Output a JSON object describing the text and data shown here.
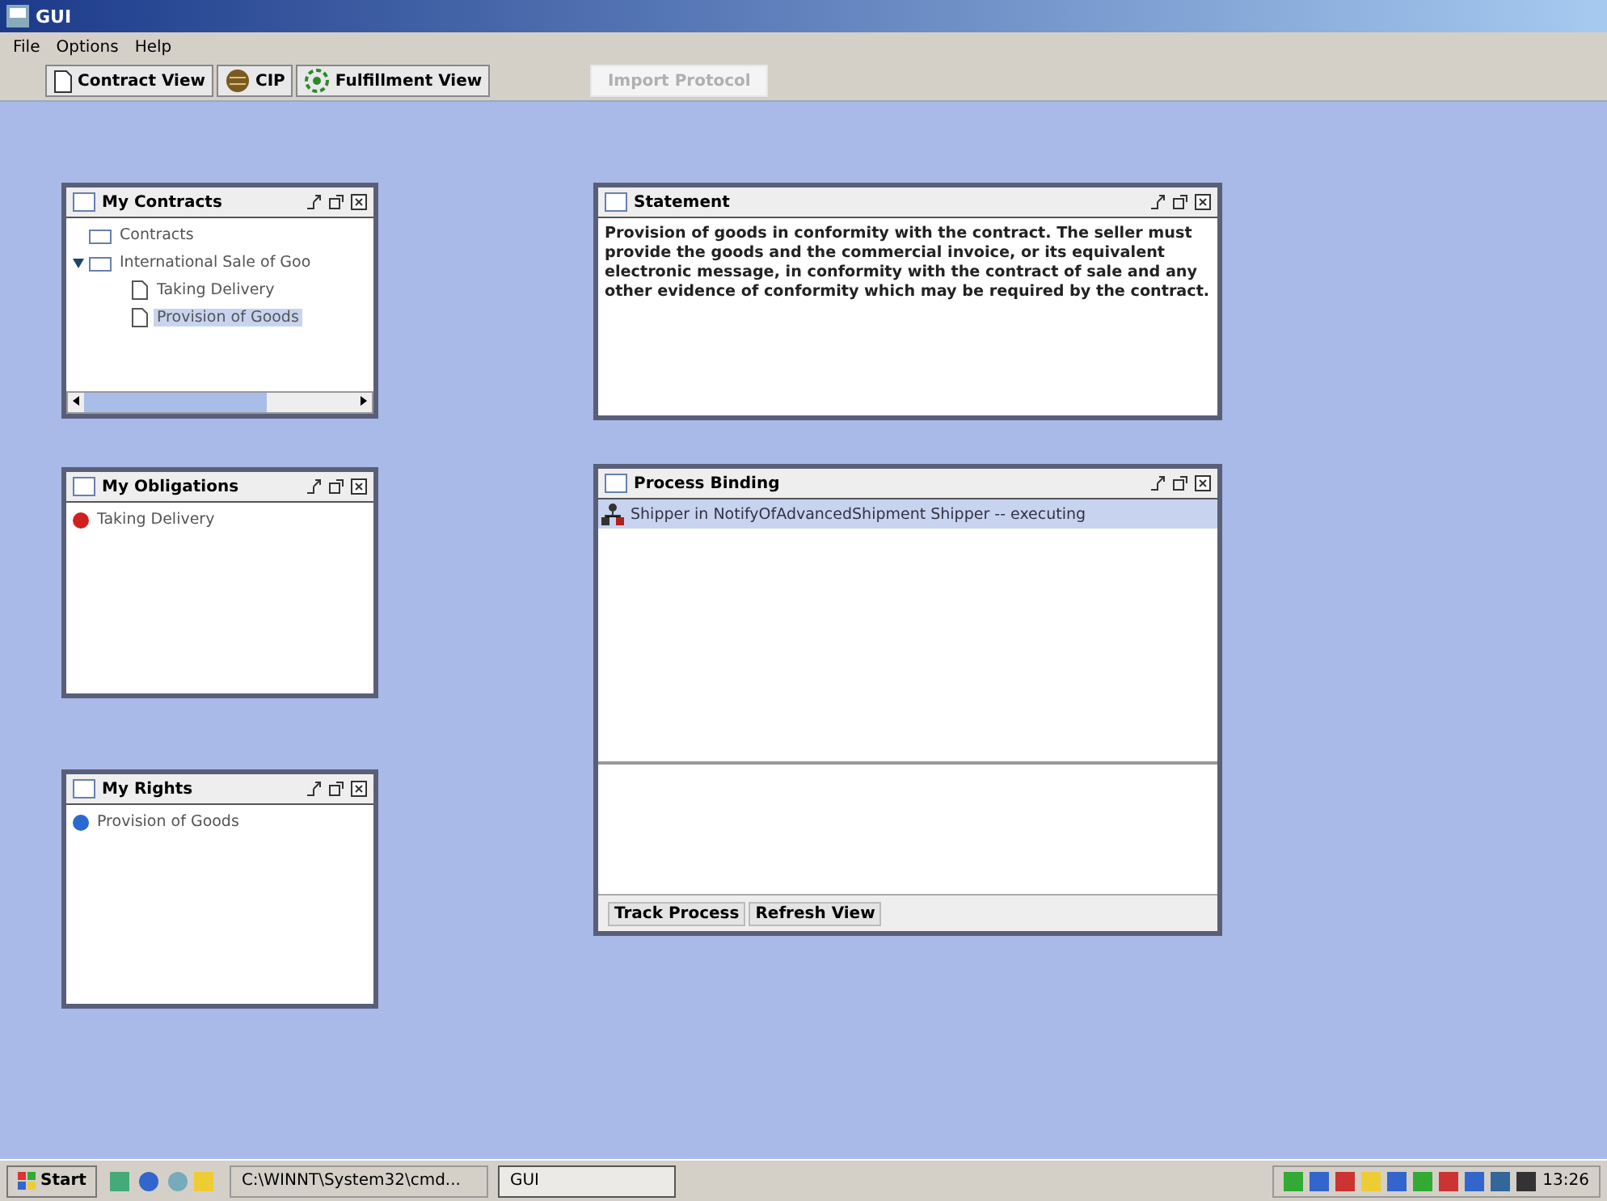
{
  "window": {
    "title": "GUI"
  },
  "menu": [
    "File",
    "Options",
    "Help"
  ],
  "toolbar": [
    {
      "kind": "document",
      "label": "Contract View"
    },
    {
      "kind": "cip",
      "label": "CIP"
    },
    {
      "kind": "fulfillment",
      "label": "Fulfillment View"
    },
    {
      "kind": "disabled",
      "label": "Import Protocol"
    }
  ],
  "frames": [
    {
      "kind": "tree",
      "title": "My Contracts",
      "items": [
        {
          "label": "Contracts",
          "kind": "folder",
          "selected": false,
          "expanded": false
        },
        {
          "label": "International Sale of Goo",
          "kind": "folder",
          "selected": false,
          "expanded": true,
          "children": [
            {
              "label": "Taking Delivery",
              "kind": "doc",
              "selected": false
            },
            {
              "label": "Provision of Goods",
              "kind": "doc",
              "selected": true
            }
          ]
        }
      ]
    },
    {
      "kind": "list",
      "title": "My Obligations",
      "items": [
        {
          "label": "Taking Delivery",
          "color": "#d02020"
        }
      ]
    },
    {
      "kind": "list",
      "title": "My Rights",
      "items": [
        {
          "label": "Provision of Goods",
          "color": "#2a6ad0"
        }
      ]
    },
    {
      "kind": "text",
      "title": "Statement",
      "text": "Provision of goods in conformity with the contract. The seller must provide the goods and the commercial invoice, or its equivalent electronic message, in conformity with the contract of sale and any other evidence of conformity which may be required by the contract."
    },
    {
      "kind": "process",
      "title": "Process Binding",
      "rows": [
        {
          "label": "Shipper in NotifyOfAdvancedShipment Shipper -- executing",
          "selected": true
        }
      ],
      "buttons": [
        "Track Process",
        "Refresh View"
      ]
    }
  ],
  "taskbar": {
    "start": "Start",
    "tasks": [
      {
        "label": "C:\\WINNT\\System32\\cmd...",
        "selected": false
      },
      {
        "label": "GUI",
        "selected": true
      }
    ],
    "clock": "13:26"
  }
}
